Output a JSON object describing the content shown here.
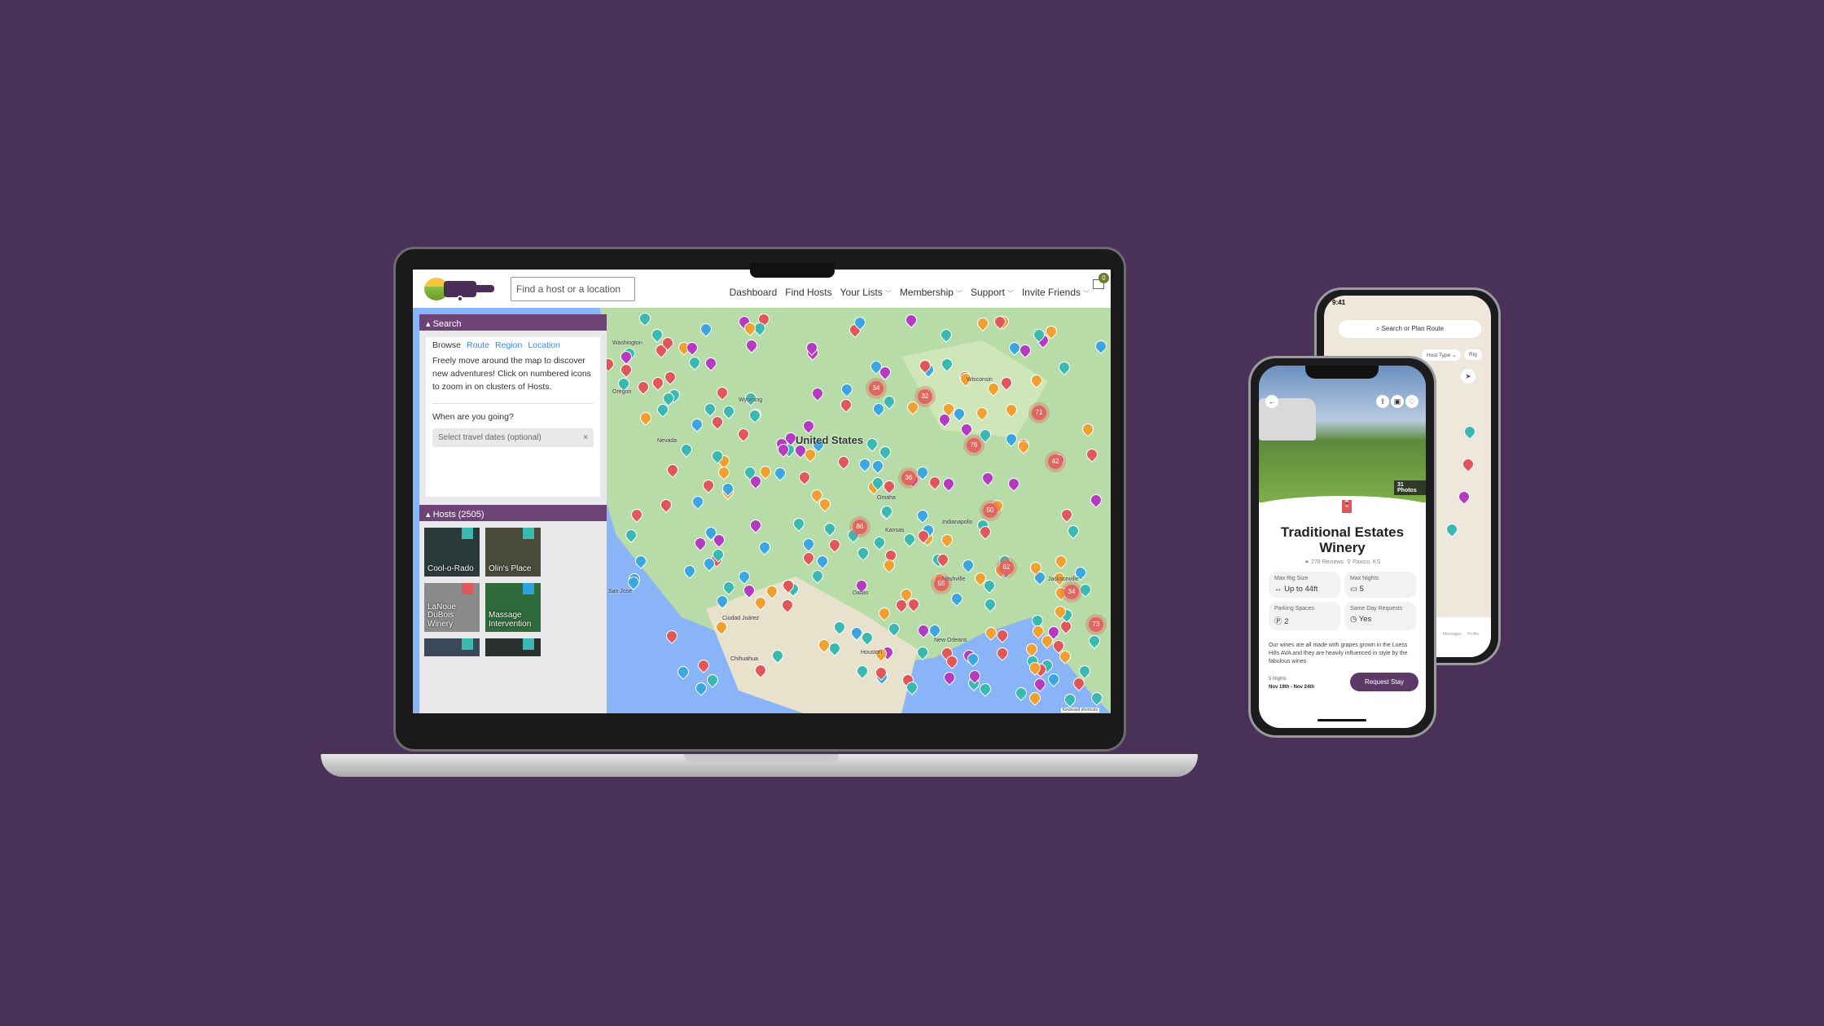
{
  "laptop": {
    "search_placeholder": "Find a host or a location",
    "nav": [
      "Dashboard",
      "Find Hosts",
      "Your Lists",
      "Membership",
      "Support",
      "Invite Friends"
    ],
    "inbox_count": "0",
    "search_panel": {
      "title": "Search",
      "tabs": [
        "Browse",
        "Route",
        "Region",
        "Location"
      ],
      "description": "Freely move around the map to discover new adventures! Click on numbered icons to zoom in on clusters of Hosts.",
      "date_label": "When are you going?",
      "date_placeholder": "Select travel dates (optional)",
      "clear": "×"
    },
    "hosts_panel": {
      "title": "Hosts (2505)",
      "hosts": [
        {
          "name": "Cool-o-Rado",
          "type": "home",
          "color": "#3bb8b0",
          "bg": "#2a3a3a"
        },
        {
          "name": "Olin's Place",
          "type": "home",
          "color": "#3bb8b0",
          "bg": "#4a4a3a"
        },
        {
          "name": "LaNoue DuBois Winery",
          "type": "winery",
          "color": "#e0575a",
          "bg": "#8a8a88"
        },
        {
          "name": "Massage Intervention",
          "type": "museum",
          "color": "#2da3dd",
          "bg": "#2f6a3a"
        },
        {
          "name": "",
          "type": "home",
          "color": "#3bb8b0",
          "bg": "#3a4a5a"
        },
        {
          "name": "",
          "type": "home",
          "color": "#3bb8b0",
          "bg": "#2a3030"
        }
      ]
    },
    "map": {
      "labels": [
        "United States",
        "Dallas",
        "Houston",
        "New Orleans",
        "Nashville",
        "Indianapolis",
        "Kansas",
        "Omaha",
        "San Jose",
        "Ciudad Juárez",
        "Chihuahua",
        "Washington",
        "Oregon",
        "Nevada",
        "Wyoming",
        "Wisconsin",
        "Jacksonville",
        "Keyboard shortcuts"
      ],
      "cluster_counts": [
        "34",
        "32",
        "71",
        "76",
        "42",
        "50",
        "36",
        "86",
        "55",
        "62",
        "34",
        "73"
      ],
      "pin_colors": {
        "winery": "#e0575a",
        "farm": "#b43bbf",
        "museum": "#3ba6e0",
        "home": "#3bb8b0",
        "golf": "#f0a030"
      }
    }
  },
  "phone_front": {
    "photos": "31 Photos",
    "title": "Traditional Estates Winery",
    "reviews": "278 Reviews",
    "location": "Paxico, KS",
    "stats": [
      {
        "label": "Max Rig Size",
        "value": "Up to 44ft",
        "icon": "↔"
      },
      {
        "label": "Max Nights",
        "value": "5",
        "icon": "▭"
      },
      {
        "label": "Parking Spaces",
        "value": "2",
        "icon": "Ⓟ"
      },
      {
        "label": "Same Day Requests",
        "value": "Yes",
        "icon": "◷"
      }
    ],
    "description": "Our wines are all made with grapes grown in the Loess Hills AVA and they are heavily influenced in style by the fabulous wines",
    "nights": "5 Nights",
    "dates": "Nov 19th - Nov 24th",
    "cta": "Request Stay",
    "time": "9:41"
  },
  "phone_back": {
    "time": "9:41",
    "search": "Search or Plan Route",
    "filters": [
      "Host Type",
      "Rig"
    ],
    "tabs": [
      "Messages",
      "Profile"
    ]
  },
  "colors": {
    "brand": "#6e4477",
    "background": "#4a3157",
    "link": "#3b8ae0"
  }
}
